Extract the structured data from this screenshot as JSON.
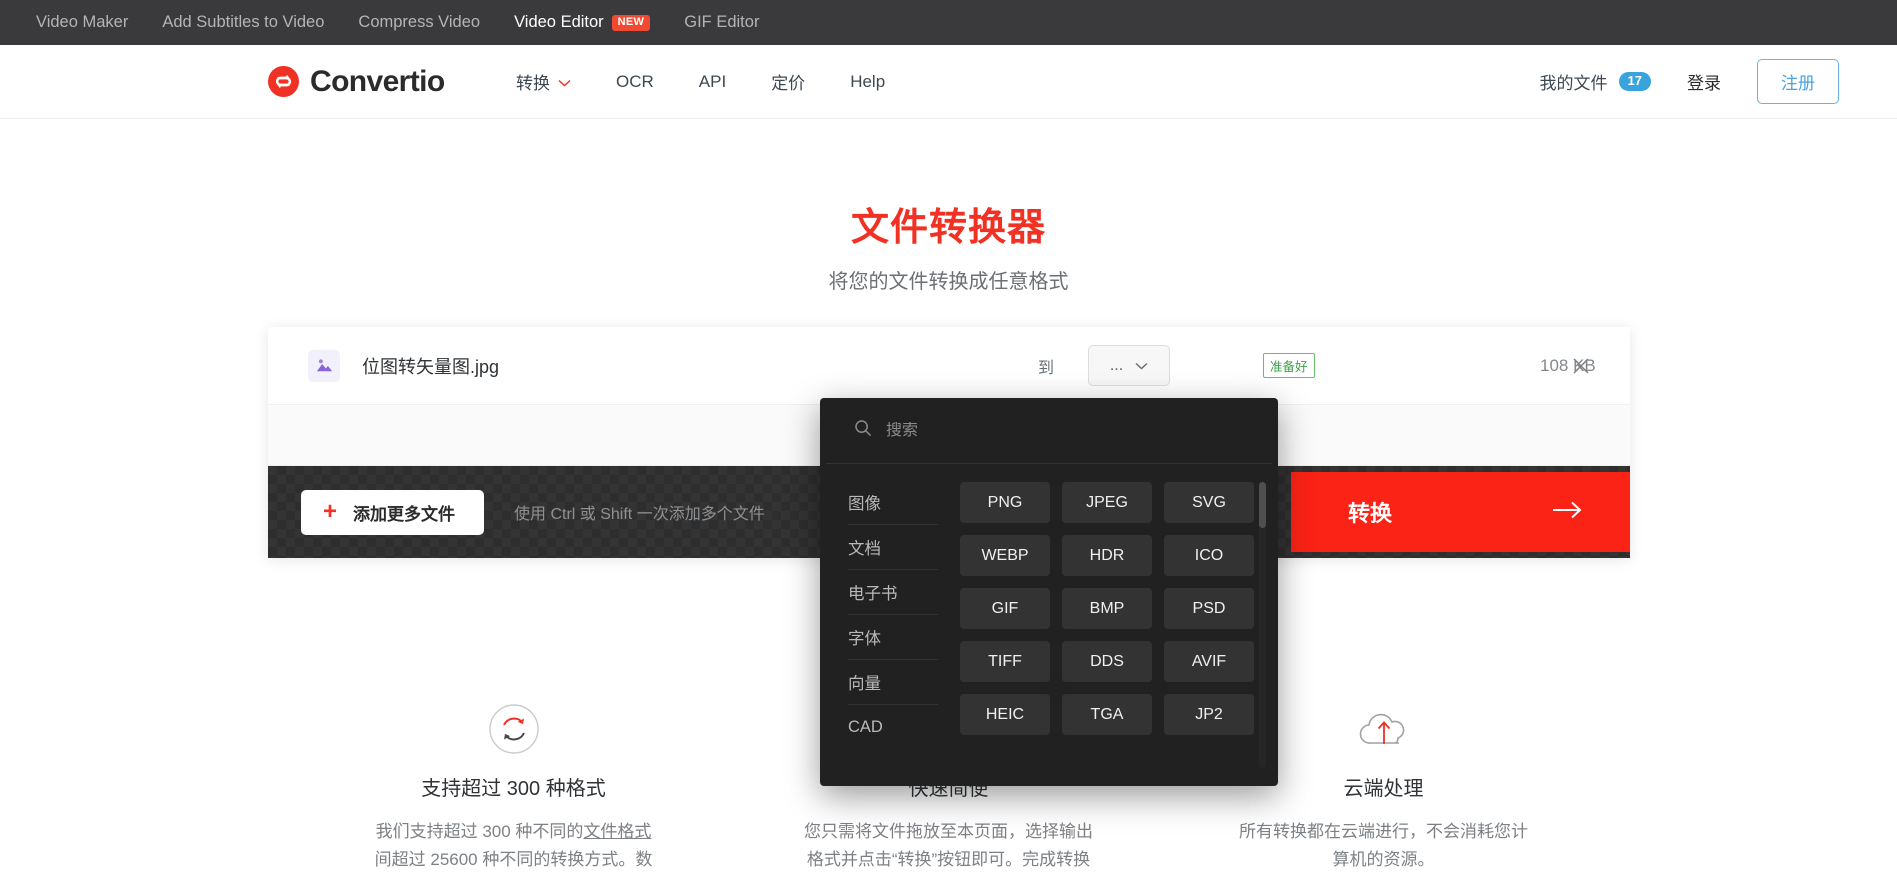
{
  "topbar": {
    "items": [
      {
        "label": "Video Maker",
        "active": false,
        "badge": ""
      },
      {
        "label": "Add Subtitles to Video",
        "active": false,
        "badge": ""
      },
      {
        "label": "Compress Video",
        "active": false,
        "badge": ""
      },
      {
        "label": "Video Editor",
        "active": true,
        "badge": "NEW"
      },
      {
        "label": "GIF Editor",
        "active": false,
        "badge": ""
      }
    ]
  },
  "header": {
    "brand": "Convertio",
    "nav": [
      {
        "label": "转换",
        "caret": true
      },
      {
        "label": "OCR",
        "caret": false
      },
      {
        "label": "API",
        "caret": false
      },
      {
        "label": "定价",
        "caret": false
      },
      {
        "label": "Help",
        "caret": false
      }
    ],
    "my_files_label": "我的文件",
    "my_files_count": "17",
    "login_label": "登录",
    "signup_label": "注册"
  },
  "hero": {
    "title": "文件转换器",
    "subtitle": "将您的文件转换成任意格式"
  },
  "file_row": {
    "name": "位图转矢量图.jpg",
    "to_label": "到",
    "format_value": "...",
    "status": "准备好",
    "size": "108 KB"
  },
  "actions": {
    "add_more_label": "添加更多文件",
    "hint": "使用 Ctrl 或 Shift 一次添加多个文件",
    "convert_label": "转换"
  },
  "dropdown": {
    "search_placeholder": "搜索",
    "categories": [
      "图像",
      "文档",
      "电子书",
      "字体",
      "向量",
      "CAD"
    ],
    "formats": [
      "PNG",
      "JPEG",
      "SVG",
      "WEBP",
      "HDR",
      "ICO",
      "GIF",
      "BMP",
      "PSD",
      "TIFF",
      "DDS",
      "AVIF",
      "HEIC",
      "TGA",
      "JP2"
    ]
  },
  "features": [
    {
      "icon": "refresh-circle-icon",
      "title": "支持超过 300 种格式",
      "text_before": "我们支持超过 300 种不同的",
      "text_link": "文件格式",
      "text_after": "间超过 25600 种不同的转换方式。数"
    },
    {
      "icon": "lightning-icon",
      "title": "快速简便",
      "text_before": "您只需将文件拖放至本页面，选择输出",
      "text_link": "",
      "text_after": "格式并点击“转换”按钮即可。完成转换"
    },
    {
      "icon": "cloud-upload-icon",
      "title": "云端处理",
      "text_before": "所有转换都在云端进行，不会消耗您计",
      "text_link": "",
      "text_after": "算机的资源。"
    }
  ],
  "colors": {
    "brand_red": "#f03123",
    "convert_red": "#fb2216",
    "badge_blue": "#38a3dd",
    "status_green": "#3f9f4a",
    "panel_dark": "#212121"
  }
}
